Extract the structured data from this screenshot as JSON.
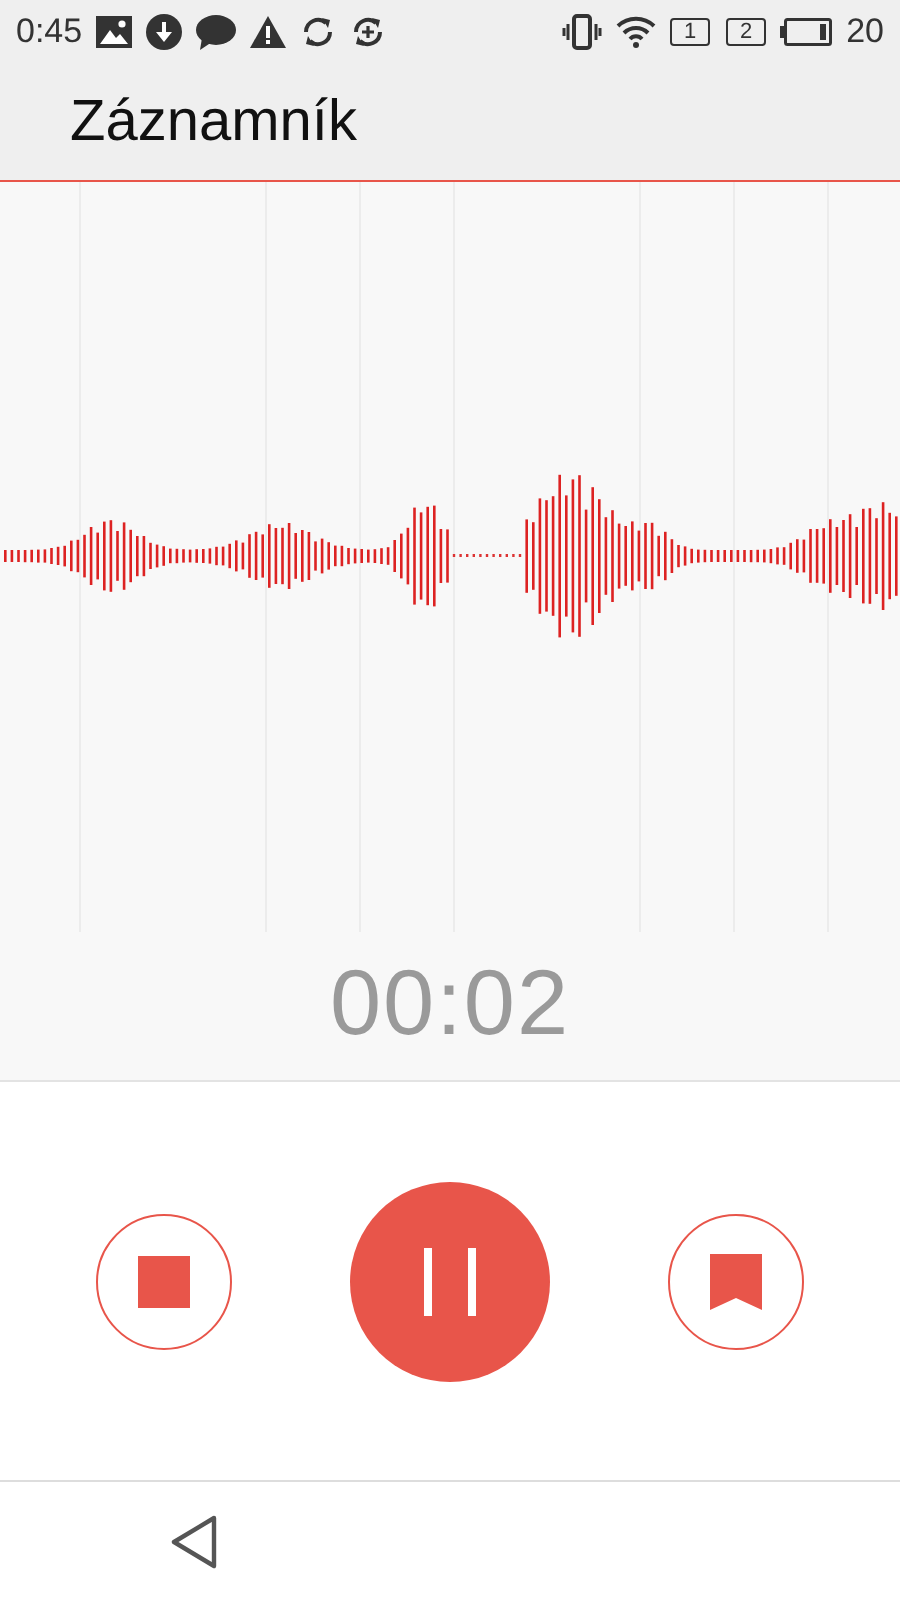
{
  "status_bar": {
    "time": "0:45",
    "sim_slots": [
      "1",
      "2"
    ],
    "battery": "20"
  },
  "app_bar": {
    "title": "Záznamník"
  },
  "recorder": {
    "elapsed": "00:02"
  },
  "controls": [
    {
      "kind": "stop"
    },
    {
      "kind": "pause"
    },
    {
      "kind": "bookmark"
    }
  ]
}
